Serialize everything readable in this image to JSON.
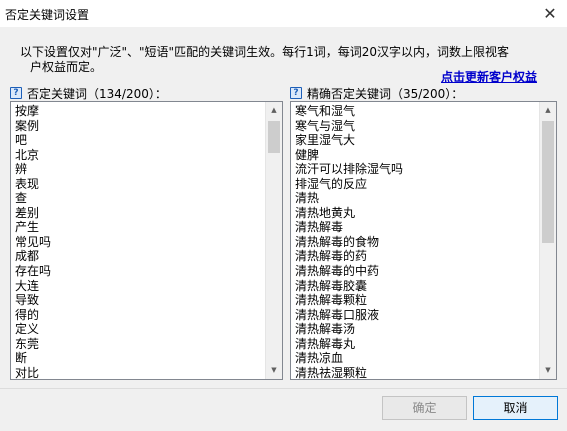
{
  "window": {
    "title": "否定关键词设置",
    "close_glyph": "✕"
  },
  "intro": {
    "line1": "以下设置仅对\"广泛\"、\"短语\"匹配的关键词生效。每行1词，每词20汉字以内，词数上限视客",
    "line2": "户权益而定。"
  },
  "update_link": "点击更新客户权益",
  "help_icon_glyph": "?",
  "negative": {
    "label": "否定关键词（134/200）：",
    "items": [
      "按摩",
      "案例",
      "吧",
      "北京",
      "辨",
      "表现",
      "查",
      "差别",
      "产生",
      "常见吗",
      "成都",
      "存在吗",
      "大连",
      "导致",
      "得的",
      "定义",
      "东莞",
      "断",
      "对比"
    ]
  },
  "exact_negative": {
    "label": "精确否定关键词（35/200）：",
    "items": [
      "寒气和湿气",
      "寒气与湿气",
      "家里湿气大",
      "健脾",
      "流汗可以排除湿气吗",
      "排湿气的反应",
      "清热",
      "清热地黄丸",
      "清热解毒",
      "清热解毒的食物",
      "清热解毒的药",
      "清热解毒的中药",
      "清热解毒胶囊",
      "清热解毒颗粒",
      "清热解毒口服液",
      "清热解毒汤",
      "清热解毒丸",
      "清热凉血",
      "清热祛湿颗粒"
    ]
  },
  "buttons": {
    "ok": "确定",
    "cancel": "取消"
  }
}
